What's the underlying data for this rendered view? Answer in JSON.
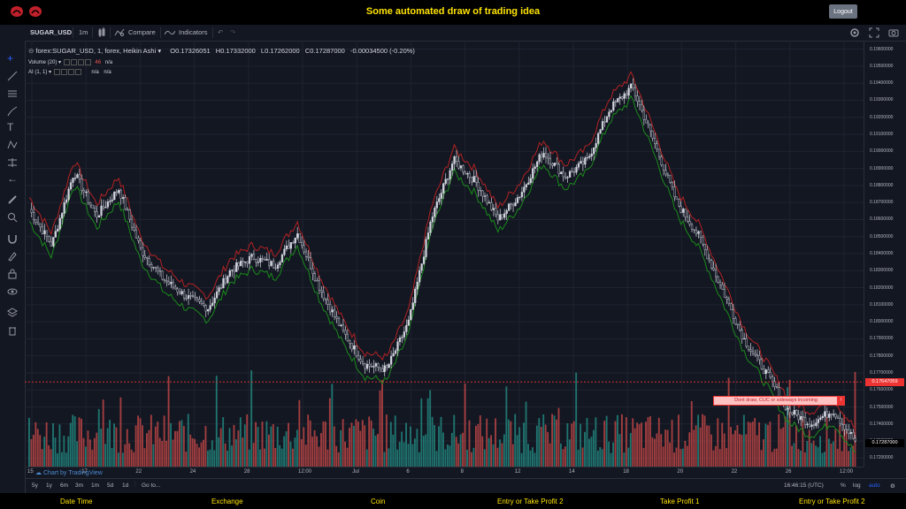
{
  "app": {
    "title": "Some automated draw of trading idea",
    "logout_label": "Logout"
  },
  "toolbar": {
    "symbol": "SUGAR_USD",
    "interval": "1m",
    "compare_label": "Compare",
    "indicators_label": "Indicators"
  },
  "legend": {
    "main": "forex:SUGAR_USD, 1, forex, Heikin Ashi",
    "o_label": "O",
    "o": "0.17326051",
    "h_label": "H",
    "h": "0.17332000",
    "l_label": "L",
    "l": "0.17262000",
    "c_label": "C",
    "c": "0.17287000",
    "change": "-0.00034500 (-0.20%)",
    "volume_label": "Volume (20)",
    "volume_val": "n/a",
    "ai_label": "AI (1, 1)",
    "ai_val1": "n/a",
    "ai_val2": "n/a"
  },
  "price_axis": [
    "0.19600000",
    "0.19500000",
    "0.19400000",
    "0.19300000",
    "0.19200000",
    "0.19100000",
    "0.19000000",
    "0.18900000",
    "0.18800000",
    "0.18700000",
    "0.18600000",
    "0.18500000",
    "0.18400000",
    "0.18300000",
    "0.18200000",
    "0.18100000",
    "0.18000000",
    "0.17900000",
    "0.17800000",
    "0.17700000",
    "0.17600000",
    "0.17500000",
    "0.17400000",
    "0.17300000",
    "0.17200000"
  ],
  "price_tags": {
    "alert_line": "0.17647059",
    "last": "0.17287000"
  },
  "alert_text": "Dont draw, CUC or sideways incoming",
  "time_axis": [
    "15",
    "17",
    "22",
    "24",
    "28",
    "12:00",
    "Jul",
    "6",
    "8",
    "12",
    "14",
    "18",
    "20",
    "22",
    "26",
    "12:00"
  ],
  "bottom_toolbar": {
    "ranges": [
      "5y",
      "1y",
      "6m",
      "3m",
      "1m",
      "5d",
      "1d"
    ],
    "goto": "Go to...",
    "clock": "16:46:15 (UTC)",
    "pct": "%",
    "log": "log",
    "auto": "auto"
  },
  "tv_logo": "Chart by TradingView",
  "footer": [
    "Date Time",
    "Exchange",
    "Coin",
    "Entry or Take Profit 2",
    "Take Profit 1",
    "Entry or Take Profit 2"
  ],
  "colors": {
    "up": "#d1d4dc",
    "down": "#1e222d",
    "bull_vol": "#26a69a",
    "bear_vol": "#ef5350",
    "upper_band": "#b22222",
    "lower_band": "#1b8a1b",
    "accent": "#ffe400"
  },
  "chart_data": {
    "type": "line",
    "title": "",
    "x": [
      "15",
      "17",
      "22",
      "24",
      "28",
      "12:00",
      "Jul",
      "6",
      "8",
      "12",
      "14",
      "18",
      "20",
      "22",
      "26",
      "12:00"
    ],
    "series": [
      {
        "values": [
          0.1866,
          0.1845,
          0.1888,
          0.1862,
          0.1878,
          0.1842,
          0.1825,
          0.1815,
          0.1808,
          0.183,
          0.1838,
          0.1833,
          0.1852,
          0.182,
          0.1795,
          0.1775,
          0.1772,
          0.18,
          0.186,
          0.1895,
          0.1882,
          0.186,
          0.1875,
          0.19,
          0.1885,
          0.1895,
          0.1925,
          0.1938,
          0.1905,
          0.187,
          0.185,
          0.182,
          0.179,
          0.177,
          0.1748,
          0.174,
          0.1748,
          0.173
        ]
      }
    ],
    "ylim": [
      0.1715,
      0.1965
    ],
    "grid": true
  }
}
